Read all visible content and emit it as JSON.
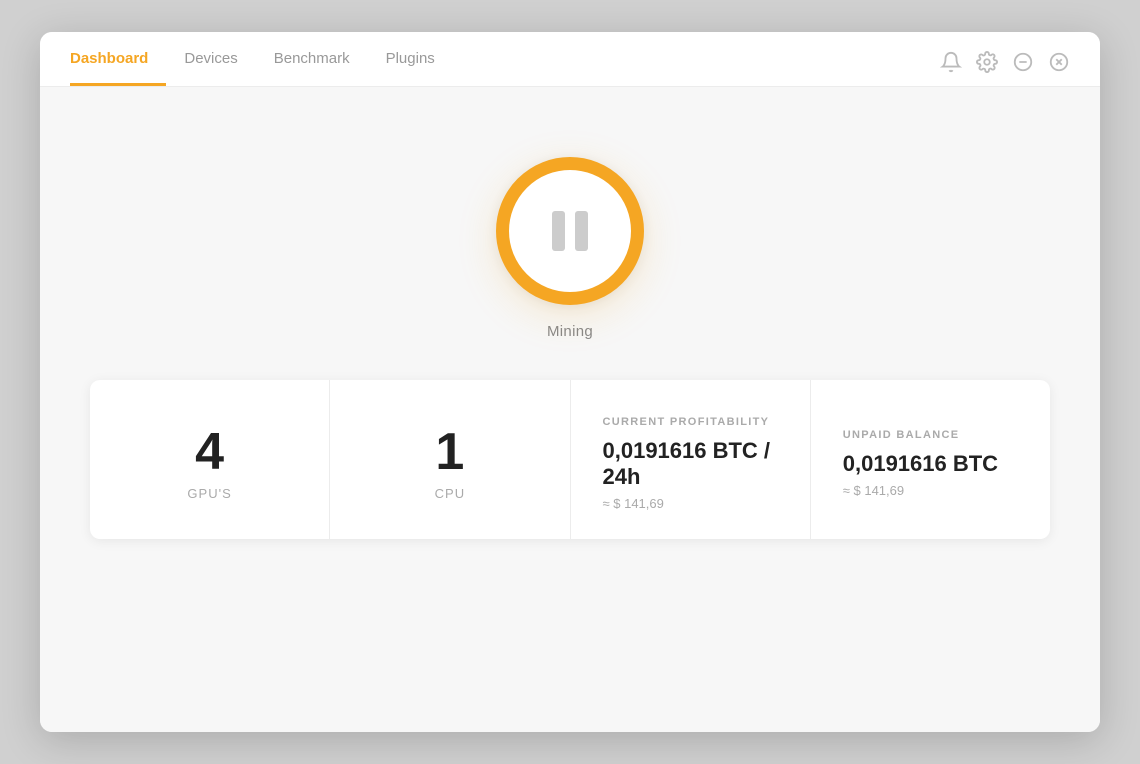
{
  "nav": {
    "tabs": [
      {
        "id": "dashboard",
        "label": "Dashboard",
        "active": true
      },
      {
        "id": "devices",
        "label": "Devices",
        "active": false
      },
      {
        "id": "benchmark",
        "label": "Benchmark",
        "active": false
      },
      {
        "id": "plugins",
        "label": "Plugins",
        "active": false
      }
    ]
  },
  "window_controls": {
    "notification_label": "🔔",
    "settings_label": "⚙",
    "minimize_label": "⊖",
    "close_label": "⊗"
  },
  "mining": {
    "button_label": "Mining",
    "status": "paused"
  },
  "stats": [
    {
      "id": "gpu",
      "number": "4",
      "label": "GPU'S"
    },
    {
      "id": "cpu",
      "number": "1",
      "label": "CPU"
    },
    {
      "id": "profitability",
      "title": "CURRENT PROFITABILITY",
      "value_main": "0,0191616 BTC / 24h",
      "value_sub": "≈ $ 141,69"
    },
    {
      "id": "balance",
      "title": "UNPAID BALANCE",
      "value_main": "0,0191616 BTC",
      "value_sub": "≈ $ 141,69"
    }
  ],
  "colors": {
    "accent": "#f5a623",
    "text_primary": "#222",
    "text_muted": "#aaa",
    "border": "#ececec"
  }
}
